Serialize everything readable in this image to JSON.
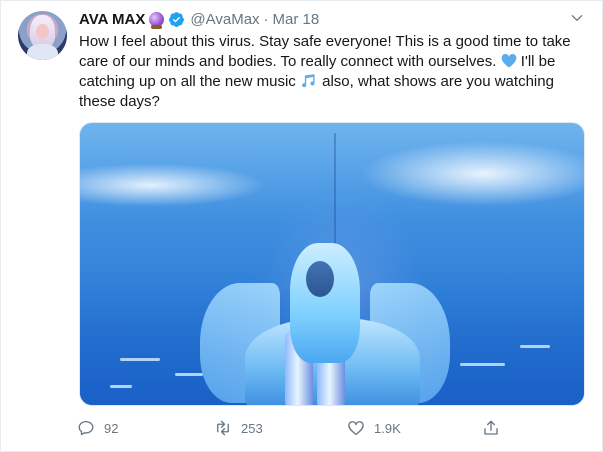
{
  "tweet": {
    "author": {
      "display_name": "AVA MAX",
      "handle": "@AvaMax"
    },
    "separator": "·",
    "date": "Mar 18",
    "text_lines": [
      "How I feel about this virus. Stay safe everyone! This is a good time to take",
      "care of our minds and bodies. To really connect with ourselves.",
      " I'll be",
      "catching up on all the new music",
      " also, what shows are you watching",
      "these days?"
    ],
    "emojis": {
      "after_name": "crystal-ball-emoji",
      "in_text_1": "blue-heart-emoji",
      "in_text_2": "musical-notes-emoji"
    },
    "media": {
      "description_icon": "photo"
    },
    "actions": {
      "replies": "92",
      "retweets": "253",
      "likes": "1.9K"
    }
  },
  "colors": {
    "verified_blue": "#1da1f2",
    "muted_gray": "#657786",
    "text": "#14171a"
  }
}
